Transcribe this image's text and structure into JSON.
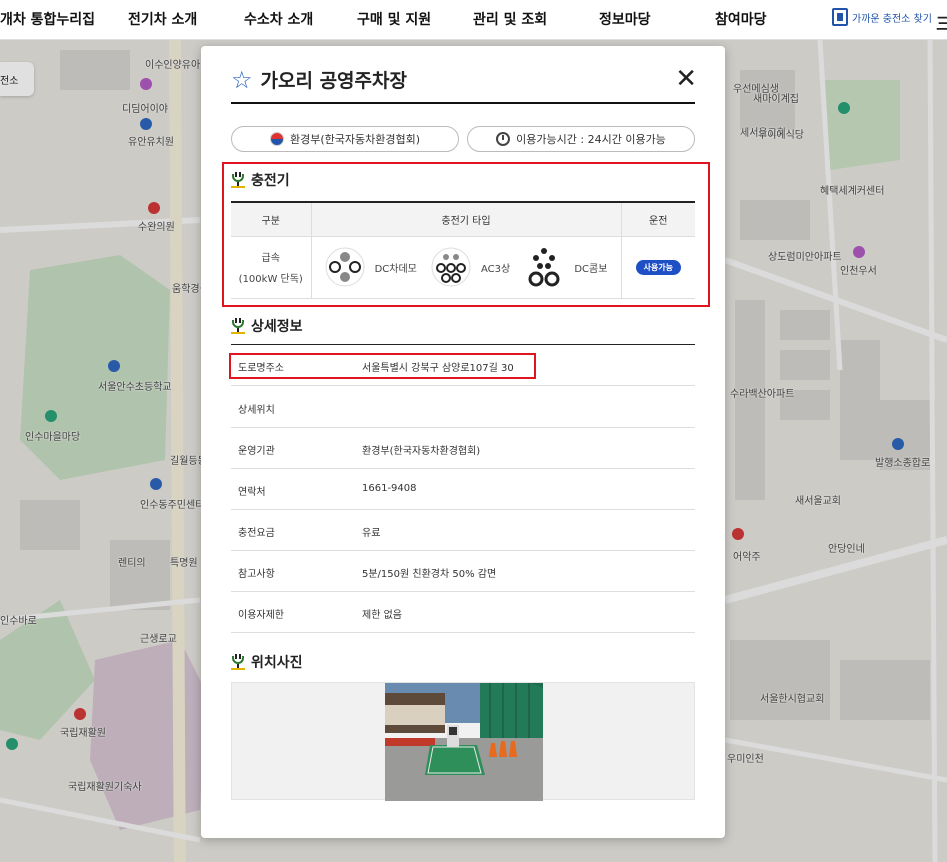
{
  "nav": {
    "items": [
      "개차 통합누리집",
      "전기차 소개",
      "수소차 소개",
      "구매 및 지원",
      "관리 및 조회",
      "정보마당",
      "참여마당"
    ],
    "nearby_label": "가까운 충전소 찾기",
    "menu_glyph": "三",
    "left_tab": "전소"
  },
  "map": {
    "labels": [
      "이수인양유아",
      "디딤어이야",
      "유안유치원",
      "수완의원",
      "움학경심년",
      "서울안수초등학교",
      "인수마을마당",
      "길월등동리",
      "인수동주민센터",
      "렌티의",
      "특명원",
      "인수바로",
      "근생로교",
      "국립재활원",
      "국립재활원기숙사",
      "우선메심생",
      "새마이계집",
      "세서울교회",
      "우이에식당",
      "혜택세계커센터",
      "인천우서",
      "상도럼미안아파트",
      "발행소종합로",
      "수라백산아파트",
      "안당인네",
      "새서울교회",
      "어악주",
      "서울한시협교회",
      "우미인천"
    ],
    "colors": {
      "map_bg": "#eae8e2",
      "block": "#d8d6d1",
      "green": "#c9dfc4",
      "road": "#fafafa",
      "campus": "#d8c6d4"
    }
  },
  "modal": {
    "title": "가오리 공영주차장",
    "close_icon": "close-icon",
    "operator_pill": "환경부(한국자동차환경협회)",
    "hours_pill": "이용가능시간 : 24시간 이용가능",
    "charger_section_title": "충전기",
    "charger_table": {
      "headers": [
        "구분",
        "충전기 타입",
        "운전"
      ],
      "row": {
        "category_line1": "급속",
        "category_line2": "(100kW 단독)",
        "types": [
          "DC차데모",
          "AC3상",
          "DC콤보"
        ],
        "status": "사용가능"
      }
    },
    "detail_section_title": "상세정보",
    "details": [
      {
        "key": "도로명주소",
        "value": "서울특별시 강북구 삼양로107길 30"
      },
      {
        "key": "상세위치",
        "value": ""
      },
      {
        "key": "운영기관",
        "value": "환경부(한국자동차환경협회)"
      },
      {
        "key": "연락처",
        "value": "1661-9408"
      },
      {
        "key": "충전요금",
        "value": "유료"
      },
      {
        "key": "참고사항",
        "value": "5분/150원 친환경차 50% 감면"
      },
      {
        "key": "이용자제한",
        "value": "제한 없음"
      }
    ],
    "photo_section_title": "위치사진",
    "colors": {
      "accent_blue": "#1e4fc4",
      "highlight_red": "#e0141e",
      "star": "#2b63c6"
    }
  }
}
